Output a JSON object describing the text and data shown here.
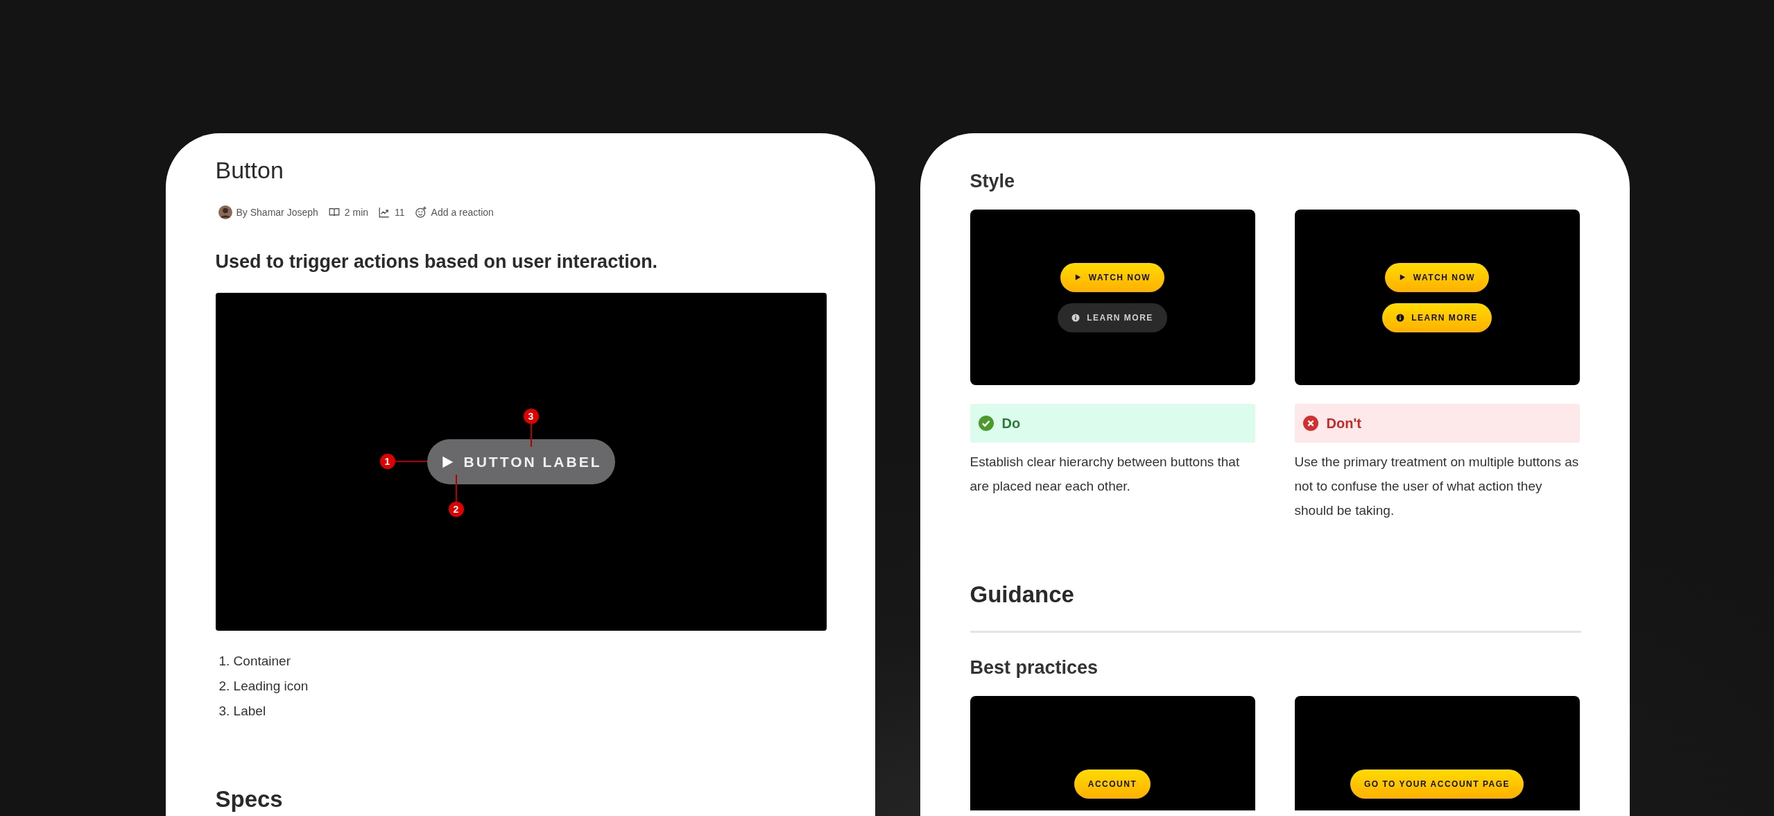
{
  "article": {
    "title": "Button",
    "meta": {
      "author": "By Shamar Joseph",
      "read_time": "2 min",
      "views": "11",
      "reaction": "Add a reaction"
    },
    "summary": "Used to trigger actions based on user interaction.",
    "anatomy": {
      "button_label": "BUTTON LABEL",
      "callouts": [
        "1",
        "2",
        "3"
      ]
    },
    "anatomy_list": [
      "1. Container",
      "2. Leading icon",
      "3. Label"
    ],
    "next_heading": "Specs"
  },
  "guide": {
    "style_heading": "Style",
    "examples": [
      {
        "kind": "do",
        "verdict_label": "Do",
        "buttons": [
          {
            "label": "WATCH NOW",
            "kind": "primary"
          },
          {
            "label": "LEARN MORE",
            "kind": "secondary"
          }
        ],
        "description": "Establish clear hierarchy between buttons that are placed near each other."
      },
      {
        "kind": "dont",
        "verdict_label": "Don't",
        "buttons": [
          {
            "label": "WATCH NOW",
            "kind": "primary"
          },
          {
            "label": "LEARN MORE",
            "kind": "primary"
          }
        ],
        "description": "Use the primary treatment on multiple buttons as not to confuse the user of what action they should be taking."
      }
    ],
    "guidance_heading": "Guidance",
    "best_practices_heading": "Best practices",
    "practice_examples": [
      {
        "buttons": [
          {
            "label": "ACCOUNT",
            "kind": "primary"
          }
        ]
      },
      {
        "buttons": [
          {
            "label": "GO TO YOUR ACCOUNT PAGE",
            "kind": "primary"
          }
        ]
      }
    ]
  }
}
